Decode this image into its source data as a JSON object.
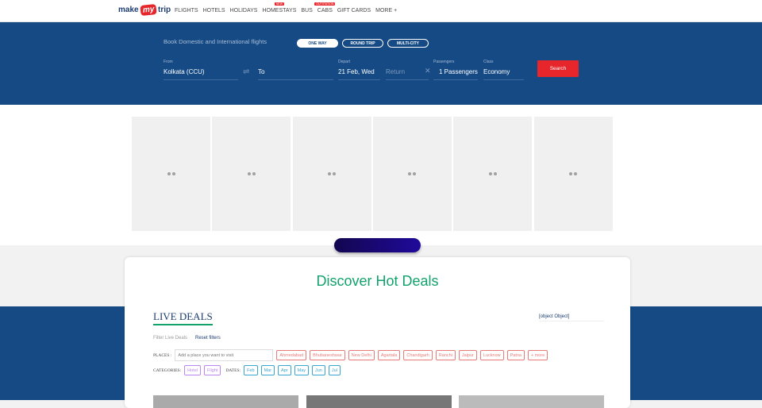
{
  "header": {
    "logo": {
      "make": "make",
      "my": "my",
      "trip": "trip"
    },
    "nav": [
      {
        "label": "FLIGHTS"
      },
      {
        "label": "HOTELS"
      },
      {
        "label": "HOLIDAYS"
      },
      {
        "label": "HOMESTAYS",
        "badge": "NEW"
      },
      {
        "label": "BUS"
      },
      {
        "label": "CABS",
        "badge": "OUTSTATION"
      },
      {
        "label": "GIFT CARDS"
      },
      {
        "label": "MORE +"
      }
    ]
  },
  "search": {
    "heading": "Book Domestic and International flights",
    "trip_types": [
      "ONE WAY",
      "ROUND TRIP",
      "MULTI-CITY"
    ],
    "selected_trip": "ONE WAY",
    "from_label": "From",
    "from": "Kolkata (CCU)",
    "to": "To",
    "depart_label": "Depart",
    "depart": "21 Feb, Wed",
    "return": "Return",
    "passengers_label": "Passengers",
    "passengers": "1 Passengers",
    "class_label": "Class",
    "class": "Economy",
    "button": "Search"
  },
  "deals": {
    "title": "Discover Hot Deals",
    "live_deals": "LIVE DEALS",
    "select_value": "[object Object]",
    "filter_label": "Filter Live Deals",
    "reset": "Reset filters",
    "places_label": "PLACES :",
    "places_placeholder": "Add a place you want to visit",
    "places": [
      "Ahmedabad",
      "Bhubaneshwar",
      "New Delhi",
      "Agartala",
      "Chandigarh",
      "Ranchi",
      "Jaipur",
      "Lucknow",
      "Patna",
      "+ more"
    ],
    "categories_label": "CATEGORIES:",
    "categories": [
      "Hotel",
      "Flight"
    ],
    "dates_label": "DATES:",
    "dates": [
      "Feb",
      "Mar",
      "Apr",
      "May",
      "Jun",
      "Jul"
    ]
  },
  "colors": {
    "brand_blue": "#154a85",
    "brand_red": "#e7262b",
    "deal_green": "#12a26b"
  }
}
